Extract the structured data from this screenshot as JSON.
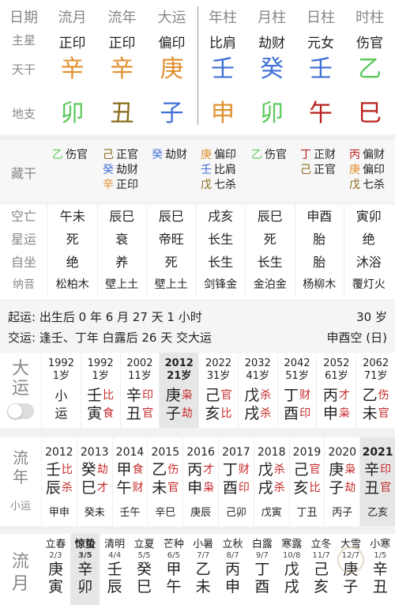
{
  "colors": {
    "metal": "#e09030",
    "water": "#3f6fd6",
    "wood": "#5cc85a",
    "earth": "#8a6a1c",
    "fire": "#b8221e",
    "god_red": "#c62828",
    "label_gray": "#888888"
  },
  "chart": {
    "headers": [
      "日期",
      "流月",
      "流年",
      "大运",
      "年柱",
      "月柱",
      "日柱",
      "时柱"
    ],
    "row_labels": {
      "star": "主星",
      "gan": "天干",
      "zhi": "地支",
      "cang": "藏干"
    },
    "columns": [
      {
        "name": "流月",
        "star": "正印",
        "gan": "辛",
        "gan_color": "#e09030",
        "zhi": "卯",
        "zhi_color": "#5cc85a"
      },
      {
        "name": "流年",
        "star": "正印",
        "gan": "辛",
        "gan_color": "#e09030",
        "zhi": "丑",
        "zhi_color": "#8a6a1c"
      },
      {
        "name": "大运",
        "star": "偏印",
        "gan": "庚",
        "gan_color": "#e09030",
        "zhi": "子",
        "zhi_color": "#3f6fd6"
      },
      {
        "name": "年柱",
        "star": "比肩",
        "gan": "壬",
        "gan_color": "#3f6fd6",
        "zhi": "申",
        "zhi_color": "#e09030"
      },
      {
        "name": "月柱",
        "star": "劫财",
        "gan": "癸",
        "gan_color": "#3f6fd6",
        "zhi": "卯",
        "zhi_color": "#5cc85a"
      },
      {
        "name": "日柱",
        "star": "元女",
        "gan": "壬",
        "gan_color": "#3f6fd6",
        "zhi": "午",
        "zhi_color": "#b8221e"
      },
      {
        "name": "时柱",
        "star": "伤官",
        "gan": "乙",
        "gan_color": "#5cc85a",
        "zhi": "巳",
        "zhi_color": "#b8221e"
      }
    ],
    "cang_gan": [
      [
        {
          "g": "乙",
          "c": "#5cc85a",
          "god": "伤官"
        }
      ],
      [
        {
          "g": "己",
          "c": "#8a6a1c",
          "god": "正官"
        },
        {
          "g": "癸",
          "c": "#3f6fd6",
          "god": "劫财"
        },
        {
          "g": "辛",
          "c": "#e09030",
          "god": "正印"
        }
      ],
      [
        {
          "g": "癸",
          "c": "#3f6fd6",
          "god": "劫财"
        }
      ],
      [
        {
          "g": "庚",
          "c": "#e09030",
          "god": "偏印"
        },
        {
          "g": "壬",
          "c": "#3f6fd6",
          "god": "比肩"
        },
        {
          "g": "戊",
          "c": "#8a6a1c",
          "god": "七杀"
        }
      ],
      [
        {
          "g": "乙",
          "c": "#5cc85a",
          "god": "伤官"
        }
      ],
      [
        {
          "g": "丁",
          "c": "#b8221e",
          "god": "正财"
        },
        {
          "g": "己",
          "c": "#8a6a1c",
          "god": "正官"
        }
      ],
      [
        {
          "g": "丙",
          "c": "#b8221e",
          "god": "偏财"
        },
        {
          "g": "庚",
          "c": "#e09030",
          "god": "偏印"
        },
        {
          "g": "戊",
          "c": "#8a6a1c",
          "god": "七杀"
        }
      ]
    ]
  },
  "info": {
    "rows": [
      {
        "label": "空亡",
        "values": [
          "午未",
          "辰巳",
          "辰巳",
          "戌亥",
          "辰巳",
          "申酉",
          "寅卯"
        ]
      },
      {
        "label": "星运",
        "values": [
          "死",
          "衰",
          "帝旺",
          "长生",
          "死",
          "胎",
          "绝"
        ]
      },
      {
        "label": "自坐",
        "values": [
          "绝",
          "养",
          "死",
          "长生",
          "长生",
          "胎",
          "沐浴"
        ]
      },
      {
        "label": "纳音",
        "values": [
          "松柏木",
          "壁上土",
          "壁上土",
          "剑锋金",
          "金泊金",
          "杨柳木",
          "覆灯火"
        ]
      }
    ]
  },
  "yun": {
    "qiyun_label": "起运:",
    "qiyun_text": "出生后 0 年 6 月 27 天 1 小时",
    "qiyun_right": "30 岁",
    "jiaoyun_label": "交运:",
    "jiaoyun_text": "逢壬、丁年 白露后 26 天 交大运",
    "jiaoyun_right": "申酉空 (日)"
  },
  "dayun": {
    "label_top": "大",
    "label_bottom": "运",
    "toggle_on": false,
    "items": [
      {
        "year": "1992",
        "age": "1岁",
        "xiao": [
          "小",
          "运"
        ]
      },
      {
        "year": "1992",
        "age": "1岁",
        "gan": "壬",
        "zhi": "寅",
        "g1": "比",
        "g2": "食"
      },
      {
        "year": "2002",
        "age": "11岁",
        "gan": "辛",
        "zhi": "丑",
        "g1": "印",
        "g2": "官"
      },
      {
        "year": "2012",
        "age": "21岁",
        "gan": "庚",
        "zhi": "子",
        "g1": "枭",
        "g2": "劫",
        "selected": true
      },
      {
        "year": "2022",
        "age": "31岁",
        "gan": "己",
        "zhi": "亥",
        "g1": "官",
        "g2": "比"
      },
      {
        "year": "2032",
        "age": "41岁",
        "gan": "戊",
        "zhi": "戌",
        "g1": "杀",
        "g2": "杀"
      },
      {
        "year": "2042",
        "age": "51岁",
        "gan": "丁",
        "zhi": "酉",
        "g1": "财",
        "g2": "印"
      },
      {
        "year": "2052",
        "age": "61岁",
        "gan": "丙",
        "zhi": "申",
        "g1": "才",
        "g2": "枭"
      },
      {
        "year": "2062",
        "age": "71岁",
        "gan": "乙",
        "zhi": "未",
        "g1": "伤",
        "g2": "官"
      }
    ]
  },
  "liunian": {
    "label_top": "流",
    "label_bottom": "年",
    "sub_label": "小运",
    "items": [
      {
        "year": "2012",
        "gan": "壬",
        "zhi": "辰",
        "g1": "比",
        "g2": "杀",
        "xy": "甲申"
      },
      {
        "year": "2013",
        "gan": "癸",
        "zhi": "巳",
        "g1": "劫",
        "g2": "才",
        "xy": "癸未"
      },
      {
        "year": "2014",
        "gan": "甲",
        "zhi": "午",
        "g1": "食",
        "g2": "财",
        "xy": "壬午"
      },
      {
        "year": "2015",
        "gan": "乙",
        "zhi": "未",
        "g1": "伤",
        "g2": "官",
        "xy": "辛巳"
      },
      {
        "year": "2016",
        "gan": "丙",
        "zhi": "申",
        "g1": "才",
        "g2": "枭",
        "xy": "庚辰"
      },
      {
        "year": "2017",
        "gan": "丁",
        "zhi": "酉",
        "g1": "财",
        "g2": "印",
        "xy": "己卯"
      },
      {
        "year": "2018",
        "gan": "戊",
        "zhi": "戌",
        "g1": "杀",
        "g2": "杀",
        "xy": "戊寅"
      },
      {
        "year": "2019",
        "gan": "己",
        "zhi": "亥",
        "g1": "官",
        "g2": "比",
        "xy": "丁丑"
      },
      {
        "year": "2020",
        "gan": "庚",
        "zhi": "子",
        "g1": "枭",
        "g2": "劫",
        "xy": "丙子"
      },
      {
        "year": "2021",
        "gan": "辛",
        "zhi": "丑",
        "g1": "印",
        "g2": "官",
        "xy": "乙亥",
        "selected": true
      }
    ]
  },
  "liuyue": {
    "label_top": "流",
    "label_bottom": "月",
    "items": [
      {
        "term": "立春",
        "date": "2/3",
        "gan": "庚",
        "zhi": "寅"
      },
      {
        "term": "惊蛰",
        "date": "3/5",
        "gan": "辛",
        "zhi": "卯",
        "selected": true
      },
      {
        "term": "清明",
        "date": "4/4",
        "gan": "壬",
        "zhi": "辰"
      },
      {
        "term": "立夏",
        "date": "5/5",
        "gan": "癸",
        "zhi": "巳"
      },
      {
        "term": "芒种",
        "date": "6/5",
        "gan": "甲",
        "zhi": "午"
      },
      {
        "term": "小暑",
        "date": "7/7",
        "gan": "乙",
        "zhi": "未"
      },
      {
        "term": "立秋",
        "date": "8/7",
        "gan": "丙",
        "zhi": "申"
      },
      {
        "term": "白露",
        "date": "9/7",
        "gan": "丁",
        "zhi": "酉"
      },
      {
        "term": "寒露",
        "date": "10/8",
        "gan": "戊",
        "zhi": "戌"
      },
      {
        "term": "立冬",
        "date": "11/7",
        "gan": "己",
        "zhi": "亥"
      },
      {
        "term": "大雪",
        "date": "12/7",
        "gan": "庚",
        "zhi": "子",
        "watermark": true
      },
      {
        "term": "小寒",
        "date": "1/5",
        "gan": "辛",
        "zhi": "丑"
      }
    ]
  }
}
